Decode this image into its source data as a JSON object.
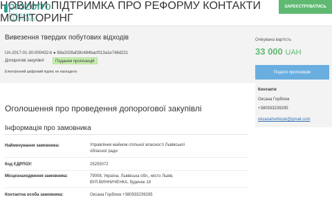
{
  "header": {
    "logo_main": "prozorro",
    "logo_sub": "ПУБЛІЧНІ ЗАКУПІВЛІ",
    "nav": [
      "НОВИНИ",
      "ПІДТРИМКА",
      "ПРО РЕФОРМУ",
      "КОНТАКТИ",
      "МОНІТОРИНГ"
    ],
    "register_label": "ЗАРЕЄСТРУВАТИСЬ"
  },
  "tender": {
    "title": "Вивезення твердих побутових відходів",
    "id_line": "UA-2017-01-30-000432-b ● 69a2028af28c484bacf013a1e748d221",
    "type": "Допорогові закупівлі",
    "status": "Подання пропозицій",
    "sign_note": "Електронний цифровий підпис не накладено",
    "value_label": "Очікувана вартість",
    "value_amount": "33 000",
    "value_currency": "UAH"
  },
  "sidebar": {
    "propose_label": "Подати пропозицію",
    "contacts_title": "Контакти",
    "contact_name": "Оксана Горблюк",
    "contact_phone": "+380933239295",
    "contact_email": "oksanahorblyuk@gmail.com"
  },
  "main": {
    "notice_title": "Оголошення про проведення допорогової закупівлі",
    "section_title": "Інформація про замовника",
    "rows": [
      {
        "label": "Найменування замовника:",
        "value": "Управління майном спільної власності Львівської обласної ради"
      },
      {
        "label": "Код ЄДРПОУ:",
        "value": "25255072"
      },
      {
        "label": "Місцезнаходження замовника:",
        "value": "79008, Україна, Львівська обл., місто Львів, ВУЛ.ВИННИЧЕНКА, будинок 18"
      },
      {
        "label": "Контактна особа замовника:",
        "value": "Оксана Горблюк +380933239295"
      }
    ]
  },
  "colors": {
    "brand": "#2a9d8f",
    "accent_green": "#5fb971",
    "button_blue": "#6aaee0",
    "band_bg": "#f3f3f3"
  }
}
